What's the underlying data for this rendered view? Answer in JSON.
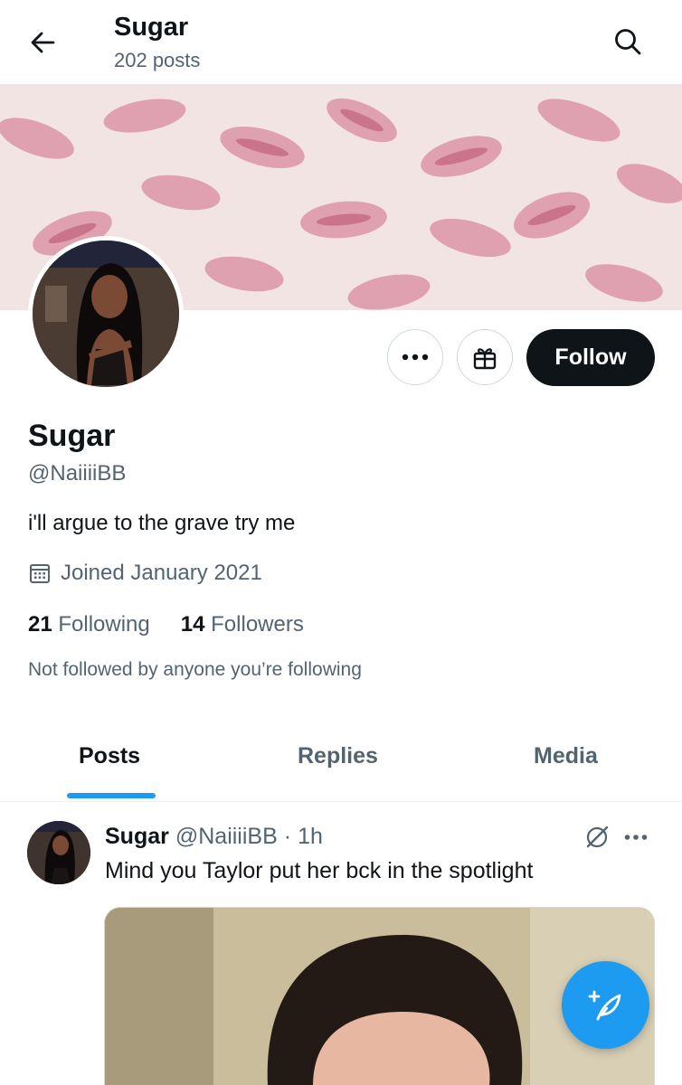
{
  "header": {
    "title": "Sugar",
    "post_count": "202 posts",
    "back_icon": "arrow-left-icon",
    "search_icon": "search-icon"
  },
  "profile": {
    "display_name": "Sugar",
    "handle": "@NaiiiiBB",
    "bio": "i'll argue to the grave try me",
    "joined": "Joined January 2021",
    "following_count": "21",
    "following_label": "Following",
    "followers_count": "14",
    "followers_label": "Followers",
    "not_followed": "Not followed by anyone you’re following"
  },
  "actions": {
    "more_icon": "more-horizontal-icon",
    "gift_icon": "gift-icon",
    "follow_label": "Follow"
  },
  "tabs": [
    {
      "label": "Posts",
      "active": true
    },
    {
      "label": "Replies",
      "active": false
    },
    {
      "label": "Media",
      "active": false
    }
  ],
  "post": {
    "author_name": "Sugar",
    "author_handle": "@NaiiiiBB",
    "separator": "·",
    "time": "1h",
    "text": "Mind you Taylor put her bck in the spotlight"
  },
  "colors": {
    "accent": "#1d9bf0",
    "text_primary": "#0f1419",
    "text_secondary": "#536471",
    "follow_bg": "#0f1419"
  }
}
